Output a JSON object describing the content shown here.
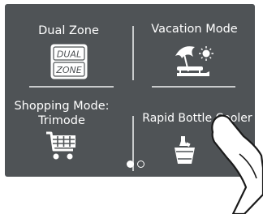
{
  "tiles": [
    {
      "label": "Dual Zone",
      "icon": "dual-zone-icon",
      "icon_text_1": "DUAL",
      "icon_text_2": "ZONE"
    },
    {
      "label": "Vacation Mode",
      "icon": "beach-vacation-icon"
    },
    {
      "label_line1": "Shopping Mode:",
      "label_line2": "Trimode",
      "icon": "shopping-cart-icon"
    },
    {
      "label": "Rapid Bottle Cooler",
      "icon": "bottle-in-ice-bucket-icon"
    }
  ],
  "pagination": {
    "pages": 2,
    "current": 1
  },
  "colors": {
    "screen_bg": "#4f5356",
    "text": "#ffffff",
    "divider": "#c9cbcc"
  }
}
